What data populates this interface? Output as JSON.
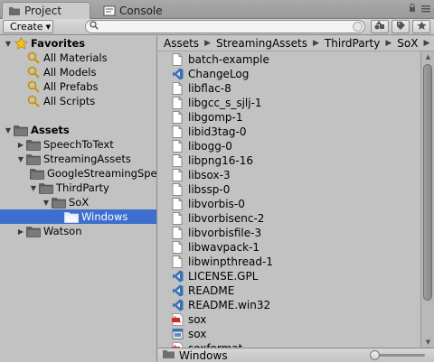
{
  "tabs": [
    {
      "label": "Project",
      "active": true
    },
    {
      "label": "Console",
      "active": false
    }
  ],
  "toolbar": {
    "create_label": "Create",
    "search_placeholder": ""
  },
  "tree": {
    "items": [
      {
        "label": "Favorites",
        "level": 0,
        "expanded": true,
        "header": true,
        "icon": "star-icon"
      },
      {
        "label": "All Materials",
        "level": 1,
        "icon": "search-icon"
      },
      {
        "label": "All Models",
        "level": 1,
        "icon": "search-icon"
      },
      {
        "label": "All Prefabs",
        "level": 1,
        "icon": "search-icon"
      },
      {
        "label": "All Scripts",
        "level": 1,
        "icon": "search-icon"
      },
      {
        "label": "Assets",
        "level": 0,
        "expanded": true,
        "header": true,
        "icon": "folder-icon"
      },
      {
        "label": "SpeechToText",
        "level": 1,
        "expanded": false,
        "icon": "folder-icon"
      },
      {
        "label": "StreamingAssets",
        "level": 1,
        "expanded": true,
        "icon": "folder-icon"
      },
      {
        "label": "GoogleStreamingSpeechToText",
        "level": 2,
        "icon": "folder-icon"
      },
      {
        "label": "ThirdParty",
        "level": 2,
        "expanded": true,
        "icon": "folder-icon"
      },
      {
        "label": "SoX",
        "level": 3,
        "expanded": true,
        "icon": "folder-icon"
      },
      {
        "label": "Windows",
        "level": 4,
        "selected": true,
        "icon": "folder-icon"
      },
      {
        "label": "Watson",
        "level": 1,
        "expanded": false,
        "icon": "folder-icon"
      }
    ]
  },
  "breadcrumb": [
    "Assets",
    "StreamingAssets",
    "ThirdParty",
    "SoX",
    "Windows"
  ],
  "files": [
    {
      "name": "batch-example",
      "icon": "document-icon"
    },
    {
      "name": "ChangeLog",
      "icon": "vs-icon"
    },
    {
      "name": "libflac-8",
      "icon": "document-icon"
    },
    {
      "name": "libgcc_s_sjlj-1",
      "icon": "document-icon"
    },
    {
      "name": "libgomp-1",
      "icon": "document-icon"
    },
    {
      "name": "libid3tag-0",
      "icon": "document-icon"
    },
    {
      "name": "libogg-0",
      "icon": "document-icon"
    },
    {
      "name": "libpng16-16",
      "icon": "document-icon"
    },
    {
      "name": "libsox-3",
      "icon": "document-icon"
    },
    {
      "name": "libssp-0",
      "icon": "document-icon"
    },
    {
      "name": "libvorbis-0",
      "icon": "document-icon"
    },
    {
      "name": "libvorbisenc-2",
      "icon": "document-icon"
    },
    {
      "name": "libvorbisfile-3",
      "icon": "document-icon"
    },
    {
      "name": "libwavpack-1",
      "icon": "document-icon"
    },
    {
      "name": "libwinpthread-1",
      "icon": "document-icon"
    },
    {
      "name": "LICENSE.GPL",
      "icon": "vs-icon"
    },
    {
      "name": "README",
      "icon": "vs-icon"
    },
    {
      "name": "README.win32",
      "icon": "vs-icon"
    },
    {
      "name": "sox",
      "icon": "pdf-icon"
    },
    {
      "name": "sox",
      "icon": "exe-icon"
    },
    {
      "name": "soxformat",
      "icon": "pdf-icon"
    }
  ],
  "status": {
    "path": "Windows",
    "zoom_fraction": 0.0
  },
  "colors": {
    "selection": "#3d6fce",
    "panel": "#c2c2c2"
  }
}
